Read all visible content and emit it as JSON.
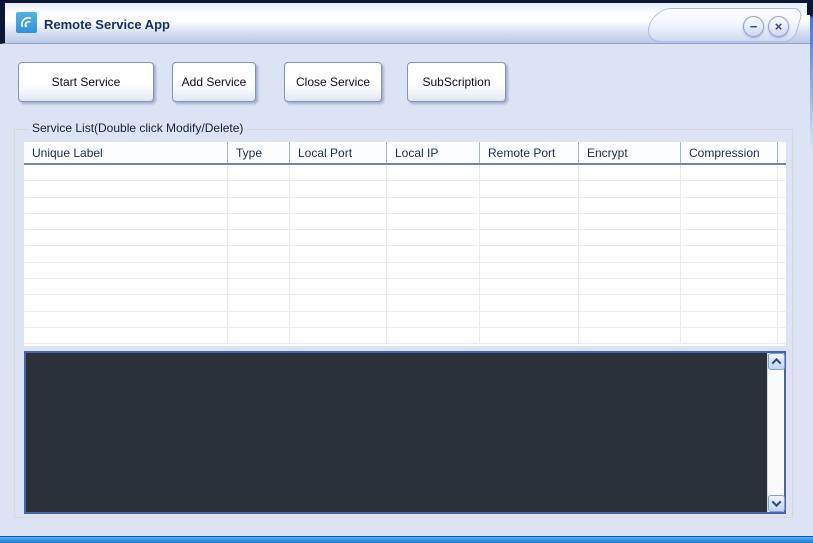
{
  "window": {
    "title": "Remote Service App"
  },
  "titlebar": {
    "title": "Remote Service App",
    "minimize_glyph": "−",
    "close_glyph": "×"
  },
  "toolbar": {
    "buttons": [
      {
        "label": "Start Service"
      },
      {
        "label": "Add Service"
      },
      {
        "label": "Close Service"
      },
      {
        "label": "SubScription"
      }
    ]
  },
  "service_list": {
    "group_label": "Service List(Double click Modify/Delete)",
    "columns": [
      "Unique Label",
      "Type",
      "Local Port",
      "Local IP",
      "Remote Port",
      "Encrypt",
      "Compression"
    ],
    "row_count": 11,
    "rows": []
  },
  "log_console": {
    "text": ""
  },
  "colors": {
    "frame_dark_navy": "#0b1634",
    "body_lavender": "#dce3f4",
    "accent_blue_strip": "#1679d2",
    "console_background": "#2a3138",
    "header_separator_blue": "#a3b5da"
  }
}
